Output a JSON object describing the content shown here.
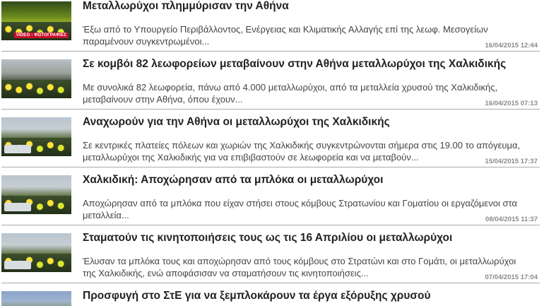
{
  "articles": [
    {
      "title": "Μεταλλωρύχοι πλημμύρισαν την Αθήνα",
      "summary": "Έξω από το Υπουργείο Περιβάλλοντος, Ενέργειας και Κλιματικής Αλλαγής επί της λεωφ. Μεσογείων παραμένουν συγκεντρωμένοι...",
      "date": "16/04/2015 12:44",
      "badge": "VIDEO - ΦΩΤΟΓΡΑΦΙΕΣ"
    },
    {
      "title": "Σε κομβόι 82 λεωφορείων μεταβαίνουν στην Αθήνα μεταλλωρύχοι της Χαλκιδικής",
      "summary": "Με συνολικά 82 λεωφορεία, πάνω από 4.000 μεταλλωρύχοι, από τα μεταλλεία χρυσού της Χαλκιδικής, μεταβαίνουν στην Αθήνα, όπου έχουν...",
      "date": "16/04/2015 07:13"
    },
    {
      "title": "Αναχωρούν για την Αθήνα οι μεταλλωρύχοι της Χαλκιδικής",
      "summary": "Σε κεντρικές πλατείες πόλεων και χωριών της Χαλκιδικής συγκεντρώνονται σήμερα στις 19.00 το απόγευμα, μεταλλωρύχοι της Χαλκιδικής για να επιβιβαστούν σε λεωφορεία και να μεταβούν...",
      "date": "15/04/2015 17:37"
    },
    {
      "title": "Χαλκιδική: Αποχώρησαν από τα μπλόκα οι μεταλλωρύχοι",
      "summary": "Αποχώρησαν από τα μπλόκα που είχαν στήσει στους κόμβους Στρατωνίου και Γοματίου οι εργαζόμενοι στα μεταλλεία...",
      "date": "08/04/2015 11:37"
    },
    {
      "title": "Σταματούν τις κινητοποιήσεις τους ως τις 16 Απριλίου οι μεταλλωρύχοι",
      "summary": "Έλυσαν τα μπλόκα τους και αποχώρησαν από τους κόμβους στο Στρατώνι και στο Γομάτι, οι μεταλλωρύχοι της Χαλκιδικής, ενώ αποφάσισαν να σταματήσουν τις κινητοποιήσεις...",
      "date": "07/04/2015 17:04"
    },
    {
      "title": "Προσφυγή στο ΣτΕ για να ξεμπλοκάρουν τα έργα εξόρυξης χρυσού"
    }
  ]
}
